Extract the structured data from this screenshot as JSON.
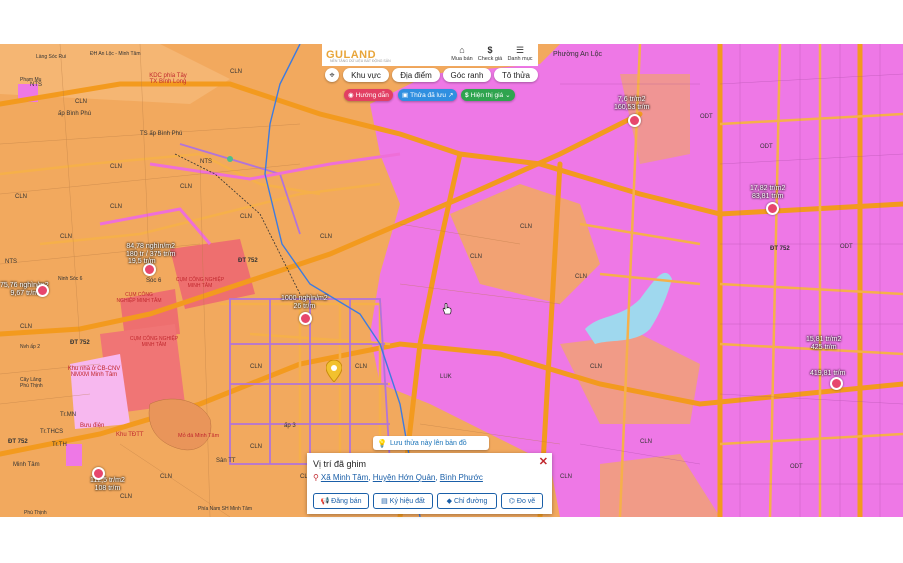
{
  "app": {
    "logo_text": "GULAND",
    "logo_subtitle": "NỀN TẢNG DỮ LIỆU BẤT ĐỘNG SẢN"
  },
  "top_buttons": [
    {
      "label": "Mua bán",
      "icon": "house-icon"
    },
    {
      "label": "Check giá",
      "icon": "dollar-icon"
    },
    {
      "label": "Danh mục",
      "icon": "menu-icon"
    }
  ],
  "chips": [
    {
      "label": "Khu vực"
    },
    {
      "label": "Địa điểm"
    },
    {
      "label": "Góc ranh"
    },
    {
      "label": "Tô thửa"
    }
  ],
  "pills": [
    {
      "label": "Hướng dẫn",
      "color": "#e23f63"
    },
    {
      "label": "Thửa đã lưu",
      "color": "#2f8fe0"
    },
    {
      "label": "Hiện thị giá",
      "color": "#2fa44f"
    }
  ],
  "save_banner": "Lưu thửa này lên bản đồ",
  "pinned_card": {
    "title": "Vị trí đã ghim",
    "addr_part1": "Xã Minh Tâm",
    "addr_sep1": ", ",
    "addr_part2": "Huyện Hớn Quản",
    "addr_sep2": ", ",
    "addr_part3": "Bình Phước",
    "buttons": [
      {
        "label": "Đăng bán",
        "icon": "megaphone-icon"
      },
      {
        "label": "Ký hiệu đất",
        "icon": "map-legend-icon"
      },
      {
        "label": "Chỉ đường",
        "icon": "direction-icon"
      },
      {
        "label": "Đo vẽ",
        "icon": "measure-icon"
      }
    ]
  },
  "price_tags": [
    {
      "line1": "7,6 tr/m2",
      "line2": "160,53 tr/m"
    },
    {
      "line1": "84,78 nghìn/m2",
      "line2": "180 tr / 375 tr/m"
    },
    {
      "line1": "19,5 tr/m",
      "line2": ""
    },
    {
      "line1": "75,76 nghìn/m2",
      "line2": "9,67 tr/m"
    },
    {
      "line1": "1000 nghìn/m2",
      "line2": "26 tr/m"
    },
    {
      "line1": "17,82 tr/m2",
      "line2": "83,81 tr/m"
    },
    {
      "line1": "15,81 tr/m2",
      "line2": "425 tr/m"
    },
    {
      "line1": "419,81 tr/m",
      "line2": ""
    },
    {
      "line1": "112,5 tr/m2",
      "line2": "108 tr/m"
    }
  ],
  "map_labels": {
    "place_1": "Phường An Lộc",
    "place_2": "ấp Bình Phú",
    "place_3": "TS ấp Bình Phú",
    "place_4": "Sóc 6",
    "place_5": "ấp 3",
    "place_6": "Sân TT",
    "place_7": "Minh Tâm",
    "place_8": "Phù Thịnh",
    "road_1": "ĐT 752",
    "road_2": "ĐT 752",
    "road_3": "ĐT 752",
    "zone_1": "KDC phía Tây TX Bình Long",
    "zone_2": "CỤM CÔNG NGHIỆP MINH TÂM",
    "zone_3": "CỤM CÔNG NGHIỆP MINH TÂM",
    "zone_4": "CỤM CÔNG NGHIỆP MINH TÂM",
    "zone_5": "Khu nhà ở CB-CNV NMXM Minh Tâm",
    "zone_6": "Mỏ đá Minh Tâm",
    "zone_7": "Bưu điện",
    "zone_8": "Khu TĐTT",
    "zone_9": "Tr.MN",
    "zone_10": "Tr.THCS",
    "zone_11": "Tr.TH",
    "zone_12": "Phạm Mu",
    "zone_13": "Cây Lăng Phú Thịnh",
    "zone_14": "Nvh ấp 2",
    "road_4": "ĐH An Lộc - Minh Tâm",
    "road_5": "Phía Nam SH Minh Tâm",
    "place_9": "Làng Sóc Rui",
    "place_10": "Ninh Sóc 6",
    "place_11": "ĐT 752"
  },
  "land_codes": [
    "CLN",
    "CLN",
    "CLN",
    "CLN",
    "CLN",
    "CLN",
    "CLN",
    "CLN",
    "CLN",
    "CLN",
    "CLN",
    "CLN",
    "NTS",
    "NTS",
    "NTS",
    "CLN",
    "CLN",
    "CLN",
    "LUK",
    "CLN",
    "CLN",
    "CLN",
    "CLN",
    "CLN",
    "CLN",
    "CLN",
    "ODT",
    "ODT",
    "ODT",
    "ODT"
  ],
  "colors": {
    "agri": "#f2a95e",
    "urban": "#ee78e6",
    "road": "#f39a1e",
    "water": "#9fd8ee",
    "industrial": "#ee6f6f",
    "accent": "#e23f63"
  }
}
